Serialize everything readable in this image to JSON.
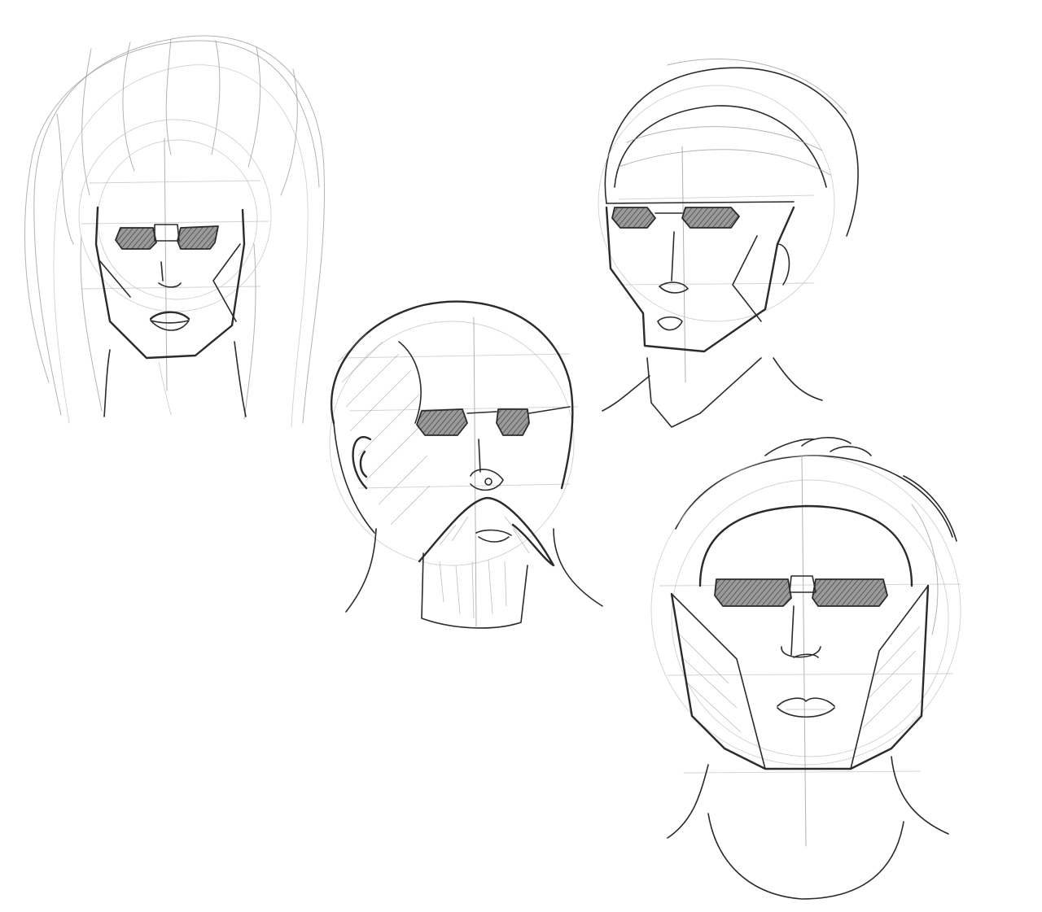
{
  "canvas": {
    "background": "#ffffff",
    "ink": "#2b2b2b",
    "guide": "#9a9a9a",
    "lens_fill": "#7a7a7a"
  },
  "sketches": [
    {
      "name": "long-hair-head"
    },
    {
      "name": "bald-mustache-head"
    },
    {
      "name": "turban-head"
    },
    {
      "name": "short-hair-head"
    }
  ]
}
